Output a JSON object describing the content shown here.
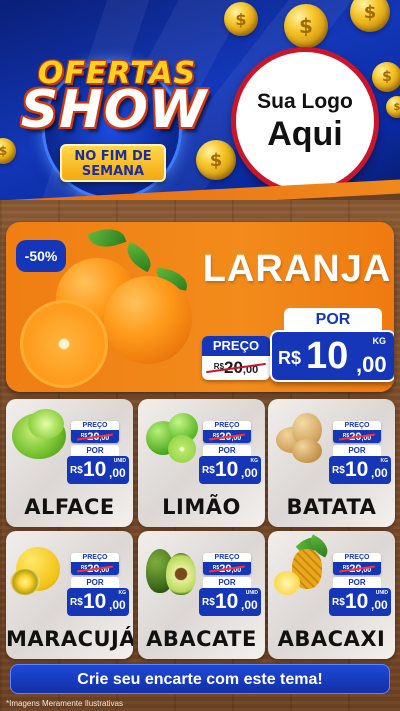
{
  "header": {
    "title_line1": "OFERTAS",
    "title_line2": "SHOW",
    "subtitle_line1": "NO FIM DE",
    "subtitle_line2": "SEMANA",
    "logo_line1": "Sua Logo",
    "logo_line2": "Aqui"
  },
  "featured": {
    "discount": "-50%",
    "name": "LARANJA",
    "preco_label": "PREÇO",
    "old_rs": "R$",
    "old_int": "20",
    "old_cents": ",00",
    "por_label": "POR",
    "currency": "R$",
    "price_int": "10",
    "price_cents": ",00",
    "unit": "KG"
  },
  "products": [
    {
      "name": "ALFACE",
      "preco_label": "PREÇO",
      "old_rs": "R$",
      "old_int": "20",
      "old_cents": ",00",
      "por_label": "POR",
      "currency": "R$",
      "price_int": "10",
      "price_cents": ",00",
      "unit": "UNID"
    },
    {
      "name": "LIMÃO",
      "preco_label": "PREÇO",
      "old_rs": "R$",
      "old_int": "20",
      "old_cents": ",00",
      "por_label": "POR",
      "currency": "R$",
      "price_int": "10",
      "price_cents": ",00",
      "unit": "KG"
    },
    {
      "name": "BATATA",
      "preco_label": "PREÇO",
      "old_rs": "R$",
      "old_int": "20",
      "old_cents": ",00",
      "por_label": "POR",
      "currency": "R$",
      "price_int": "10",
      "price_cents": ",00",
      "unit": "KG"
    },
    {
      "name": "MARACUJÁ",
      "preco_label": "PREÇO",
      "old_rs": "R$",
      "old_int": "20",
      "old_cents": ",00",
      "por_label": "POR",
      "currency": "R$",
      "price_int": "10",
      "price_cents": ",00",
      "unit": "KG"
    },
    {
      "name": "ABACATE",
      "preco_label": "PREÇO",
      "old_rs": "R$",
      "old_int": "20",
      "old_cents": ",00",
      "por_label": "POR",
      "currency": "R$",
      "price_int": "10",
      "price_cents": ",00",
      "unit": "UNID"
    },
    {
      "name": "ABACAXI",
      "preco_label": "PREÇO",
      "old_rs": "R$",
      "old_int": "20",
      "old_cents": ",00",
      "por_label": "POR",
      "currency": "R$",
      "price_int": "10",
      "price_cents": ",00",
      "unit": "UNID"
    }
  ],
  "footer": {
    "cta": "Crie seu encarte com este tema!",
    "disclaimer": "*Imagens Meramente Ilustrativas"
  },
  "colors": {
    "brand_blue": "#1636b8",
    "orange": "#f07e13",
    "gold": "#ffd21f",
    "logo_border": "#c9162a"
  },
  "icons": [
    "coin-icon",
    "orange-fruit-icon",
    "lettuce-icon",
    "lime-icon",
    "potato-icon",
    "passion-fruit-icon",
    "avocado-icon",
    "pineapple-icon"
  ]
}
